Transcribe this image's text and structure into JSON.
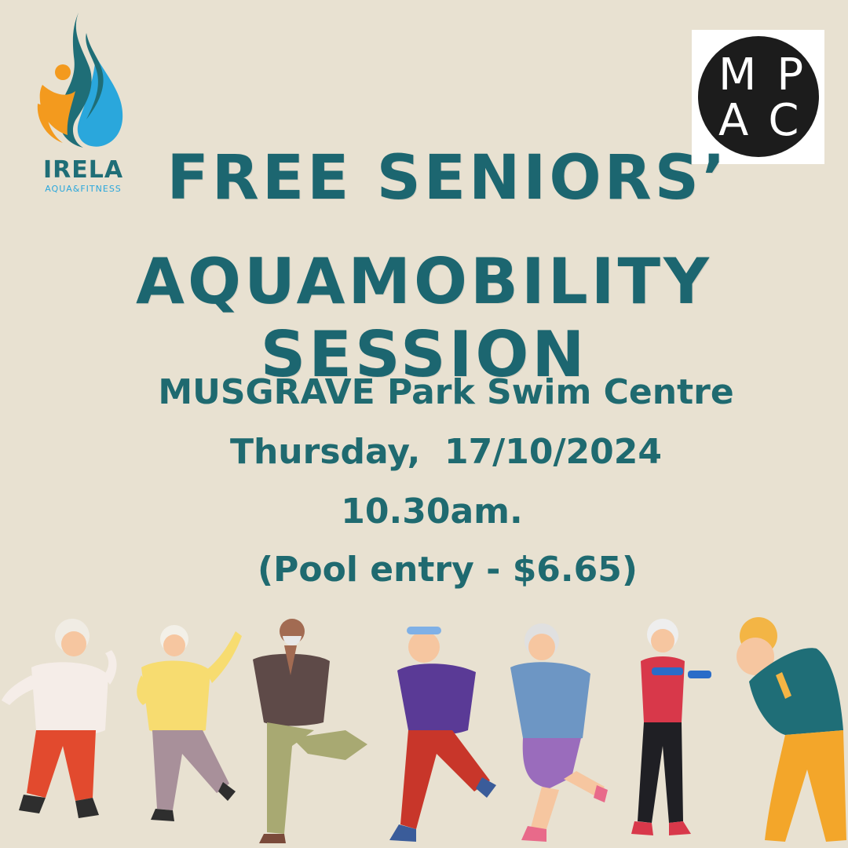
{
  "logos": {
    "irela_name": "IRELA",
    "irela_subtitle": "AQUA&FITNESS",
    "mpac_line1": "MP",
    "mpac_line2": "AC"
  },
  "headline": {
    "line1": "FREE SENIORS’",
    "line2": "AQUAMOBILITY SESSION"
  },
  "details": {
    "venue": "MUSGRAVE Park Swim Centre",
    "date": "Thursday,  17/10/2024",
    "time": "10.30am.",
    "price": "(Pool entry - $6.65)"
  },
  "colors": {
    "background": "#e8e1d1",
    "heading": "#1c6670",
    "brand_teal": "#1f6e77",
    "brand_orange": "#f39a1e",
    "brand_blue": "#2aa7dc"
  },
  "illustration": {
    "icon": "seniors-exercising-illustration",
    "figure_count": 7
  }
}
